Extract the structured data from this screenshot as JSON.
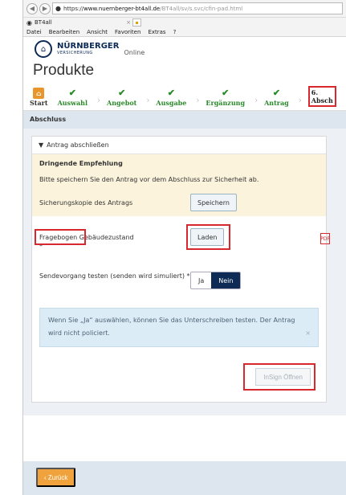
{
  "browser": {
    "url_https": "https://",
    "url_host": "www.nuernberger-bt4all.de",
    "url_path": "/BT4all/sv/s.svc/cfin-pad.html",
    "tab_title": "BT4all",
    "tab_close": "×",
    "menu": [
      "Datei",
      "Bearbeiten",
      "Ansicht",
      "Favoriten",
      "Extras",
      "?"
    ]
  },
  "brand": {
    "line1": "NÜRNBERGER",
    "line2": "VERSICHERUNG",
    "suffix": "Online"
  },
  "page_title": "Produkte",
  "stepper": {
    "home_label": "Start",
    "steps": [
      "Auswahl",
      "Angebot",
      "Ausgabe",
      "Ergänzung",
      "Antrag"
    ],
    "current_number": "6.",
    "current_label": "Absch"
  },
  "section_title": "Abschluss",
  "panel": {
    "header": "Antrag abschließen",
    "recommendation_title": "Dringende Empfehlung",
    "recommendation_text": "Bitte speichern Sie den Antrag vor dem Abschluss zur Sicherheit ab.",
    "backup_label": "Sicherungskopie des Antrags",
    "save_button": "Speichern",
    "questionnaire_label": "Fragebogen Gebäudezustand",
    "questionnaire_required": "*",
    "load_button": "Laden",
    "send_test_label": "Sendevorgang testen (senden wird simuliert) *",
    "toggle_yes": "Ja",
    "toggle_no": "Nein",
    "info_text": "Wenn Sie „Ja“ auswählen, können Sie das Unterschreiben testen. Der Antrag wird nicht policiert.",
    "info_close": "×",
    "insign_button": "InSign Öffnen"
  },
  "back_button": "Zurück"
}
